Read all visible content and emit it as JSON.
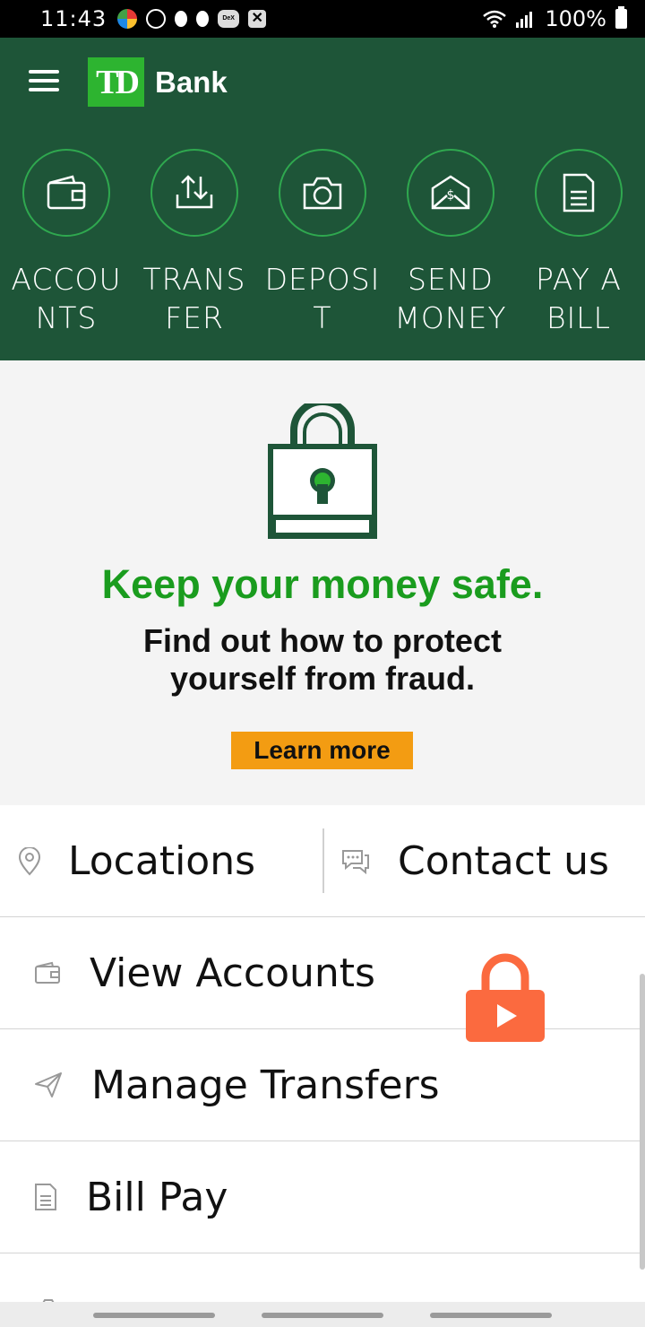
{
  "status_bar": {
    "time": "11:43",
    "dex_label": "DeX",
    "battery": "100%"
  },
  "header": {
    "logo_text": "TD",
    "brand": "Bank"
  },
  "quick_actions": [
    {
      "label": "ACCOUNTS",
      "icon": "wallet-icon"
    },
    {
      "label": "TRANSFER",
      "icon": "transfer-icon"
    },
    {
      "label": "DEPOSIT",
      "icon": "camera-icon"
    },
    {
      "label": "SEND MONEY",
      "icon": "envelope-icon"
    },
    {
      "label": "PAY A BILL",
      "icon": "bill-icon"
    }
  ],
  "promo": {
    "headline": "Keep your money safe.",
    "subtext": "Find out how to protect yourself from fraud.",
    "cta": "Learn more"
  },
  "links": {
    "locations": "Locations",
    "contact": "Contact us"
  },
  "menu": [
    {
      "label": "View Accounts",
      "icon": "wallet-icon"
    },
    {
      "label": "Manage Transfers",
      "icon": "send-icon"
    },
    {
      "label": "Bill Pay",
      "icon": "bill-icon"
    }
  ],
  "colors": {
    "brand_green": "#1e5538",
    "td_green": "#2db430",
    "headline_green": "#1a9c1e",
    "cta_orange": "#f39c12"
  }
}
